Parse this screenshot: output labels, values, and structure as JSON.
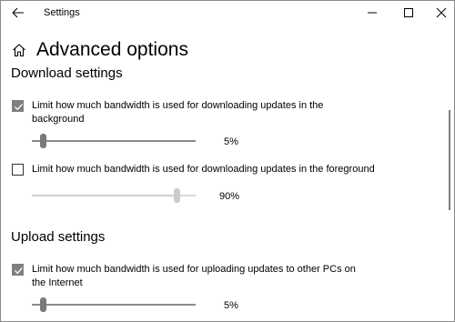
{
  "window": {
    "title": "Settings"
  },
  "header": {
    "title": "Advanced options"
  },
  "download": {
    "section_title": "Download settings",
    "background": {
      "label": "Limit how much bandwidth is used for downloading updates in the background",
      "checked": true,
      "value_percent": 5,
      "value_label": "5%"
    },
    "foreground": {
      "label": "Limit how much bandwidth is used for downloading updates in the foreground",
      "checked": false,
      "value_percent": 90,
      "value_label": "90%"
    }
  },
  "upload": {
    "section_title": "Upload settings",
    "other_pcs": {
      "label": "Limit how much bandwidth is used for uploading updates to other PCs on the Internet",
      "checked": true,
      "value_percent": 5,
      "value_label": "5%"
    }
  },
  "icons": {
    "back": "arrow-left-icon",
    "home": "home-icon",
    "minimize": "minimize-icon",
    "maximize": "maximize-icon",
    "close": "close-icon",
    "check": "checkmark-icon"
  },
  "colors": {
    "checkbox_checked": "#808080",
    "slider_active": "#7a7a7a",
    "slider_disabled": "#cccccc"
  }
}
